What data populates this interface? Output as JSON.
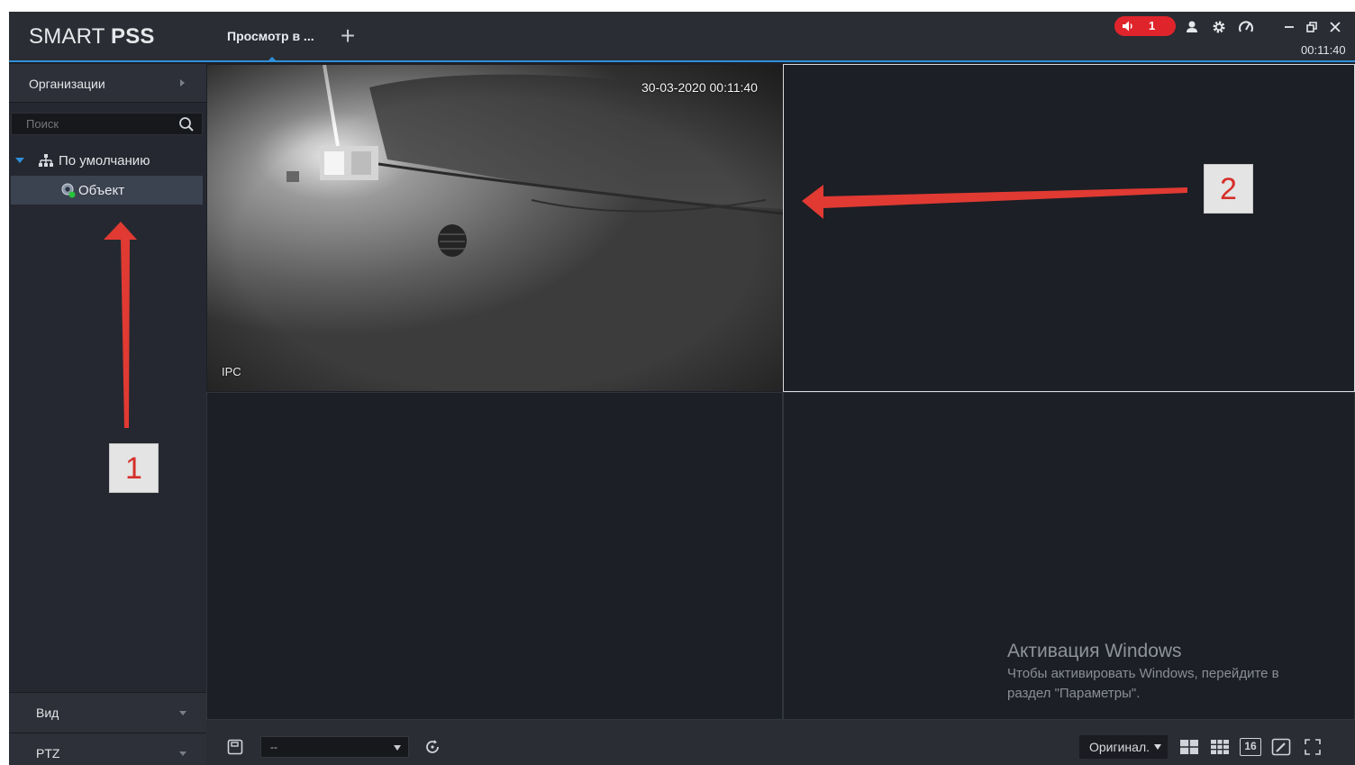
{
  "app": {
    "logo_thin": "SMART ",
    "logo_bold": "PSS",
    "tab_label": "Просмотр в ...",
    "add_tab": "+",
    "alarm_count": "1",
    "clock": "00:11:40"
  },
  "sidebar": {
    "org_header": "Организации",
    "search_placeholder": "Поиск",
    "tree_root": "По умолчанию",
    "tree_item": "Объект",
    "panel_view": "Вид",
    "panel_ptz": "PTZ"
  },
  "video": {
    "timestamp": "30-03-2020 00:11:40",
    "camera_label": "IPC"
  },
  "watermark": {
    "title": "Активация Windows",
    "line1": "Чтобы активировать Windows, перейдите в",
    "line2": "раздел \"Параметры\"."
  },
  "bottombar": {
    "select_value": "--",
    "ratio_label": "Оригинал.",
    "split16_label": "16"
  },
  "annotations": {
    "marker_1": "1",
    "marker_2": "2"
  },
  "colors": {
    "accent": "#2f8fd8",
    "alarm": "#e0242c",
    "annotation": "#d62f2a"
  }
}
